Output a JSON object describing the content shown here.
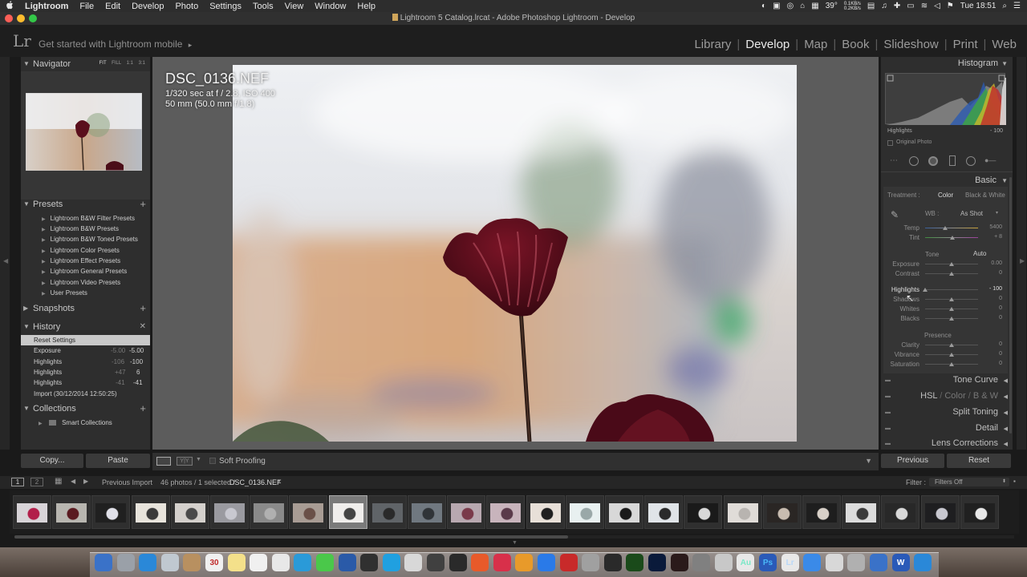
{
  "menubar": {
    "apple": "",
    "items": [
      "Lightroom",
      "File",
      "Edit",
      "Develop",
      "Photo",
      "Settings",
      "Tools",
      "View",
      "Window",
      "Help"
    ],
    "temp": "39°",
    "net_up": "0.1KB/s",
    "net_down": "0.2KB/s",
    "clock": "Tue 18:51"
  },
  "window": {
    "title": "Lightroom 5 Catalog.lrcat - Adobe Photoshop Lightroom - Develop"
  },
  "header": {
    "logo": "Lr",
    "mobile": "Get started with Lightroom mobile",
    "mobile_arrow": "▸",
    "modules": [
      "Library",
      "Develop",
      "Map",
      "Book",
      "Slideshow",
      "Print",
      "Web"
    ],
    "active_module": "Develop"
  },
  "navigator": {
    "title": "Navigator",
    "zoom": [
      "FIT",
      "FILL",
      "1:1",
      "3:1"
    ]
  },
  "presets": {
    "title": "Presets",
    "items": [
      "Lightroom B&W Filter Presets",
      "Lightroom B&W Presets",
      "Lightroom B&W Toned Presets",
      "Lightroom Color Presets",
      "Lightroom Effect Presets",
      "Lightroom General Presets",
      "Lightroom Video Presets",
      "User Presets"
    ]
  },
  "snapshots": {
    "title": "Snapshots"
  },
  "history": {
    "title": "History",
    "rows": [
      {
        "label": "Reset Settings",
        "a": "",
        "b": ""
      },
      {
        "label": "Exposure",
        "a": "-5.00",
        "b": "-5.00"
      },
      {
        "label": "Highlights",
        "a": "-106",
        "b": "-100"
      },
      {
        "label": "Highlights",
        "a": "+47",
        "b": "6"
      },
      {
        "label": "Highlights",
        "a": "-41",
        "b": "-41"
      },
      {
        "label": "Import (30/12/2014 12:50:25)",
        "a": "",
        "b": ""
      }
    ]
  },
  "collections": {
    "title": "Collections",
    "items": [
      "Smart Collections"
    ]
  },
  "left_buttons": {
    "copy": "Copy...",
    "paste": "Paste"
  },
  "photo_info": {
    "filename": "DSC_0136.NEF",
    "line1": "1/320 sec at f / 2.8, ISO 400",
    "line2": "50 mm (50.0 mm f/1.8)"
  },
  "toolbar": {
    "soft_proofing": "Soft Proofing"
  },
  "histogram": {
    "title": "Histogram",
    "readout_label": "Highlights",
    "readout_value": "- 100",
    "original_photo": "Original Photo"
  },
  "basic": {
    "title": "Basic",
    "treatment_label": "Treatment :",
    "color": "Color",
    "bw": "Black & White",
    "wb_label": "WB :",
    "wb_value": "As Shot",
    "tone_label": "Tone",
    "auto": "Auto",
    "presence_label": "Presence",
    "sliders": [
      {
        "label": "Temp",
        "value": "5400",
        "pos": 0.38
      },
      {
        "label": "Tint",
        "value": "+ 8",
        "pos": 0.52
      },
      {
        "label": "Exposure",
        "value": "0.00",
        "pos": 0.5
      },
      {
        "label": "Contrast",
        "value": "0",
        "pos": 0.5
      },
      {
        "label": "Highlights",
        "value": "- 100",
        "pos": 0.0
      },
      {
        "label": "Shadows",
        "value": "0",
        "pos": 0.5
      },
      {
        "label": "Whites",
        "value": "0",
        "pos": 0.5
      },
      {
        "label": "Blacks",
        "value": "0",
        "pos": 0.5
      },
      {
        "label": "Clarity",
        "value": "0",
        "pos": 0.5
      },
      {
        "label": "Vibrance",
        "value": "0",
        "pos": 0.5
      },
      {
        "label": "Saturation",
        "value": "0",
        "pos": 0.5
      }
    ]
  },
  "sections": {
    "tone_curve": "Tone Curve",
    "hsl": "HSL",
    "color": "Color",
    "bw": "B & W",
    "split_toning": "Split Toning",
    "detail": "Detail",
    "lens_corrections": "Lens Corrections"
  },
  "right_buttons": {
    "previous": "Previous",
    "reset": "Reset"
  },
  "filmstrip": {
    "screen1": "1",
    "screen2": "2",
    "source": "Previous Import",
    "count": "46 photos / 1 selected /",
    "selected_file": "DSC_0136.NEF",
    "filter_label": "Filter :",
    "filter_value": "Filters Off",
    "thumbs": 25,
    "selected_index": 8
  },
  "dock": {
    "calendar_day": "30",
    "icons": [
      "Au",
      "Ps",
      "Lr",
      "W"
    ]
  }
}
